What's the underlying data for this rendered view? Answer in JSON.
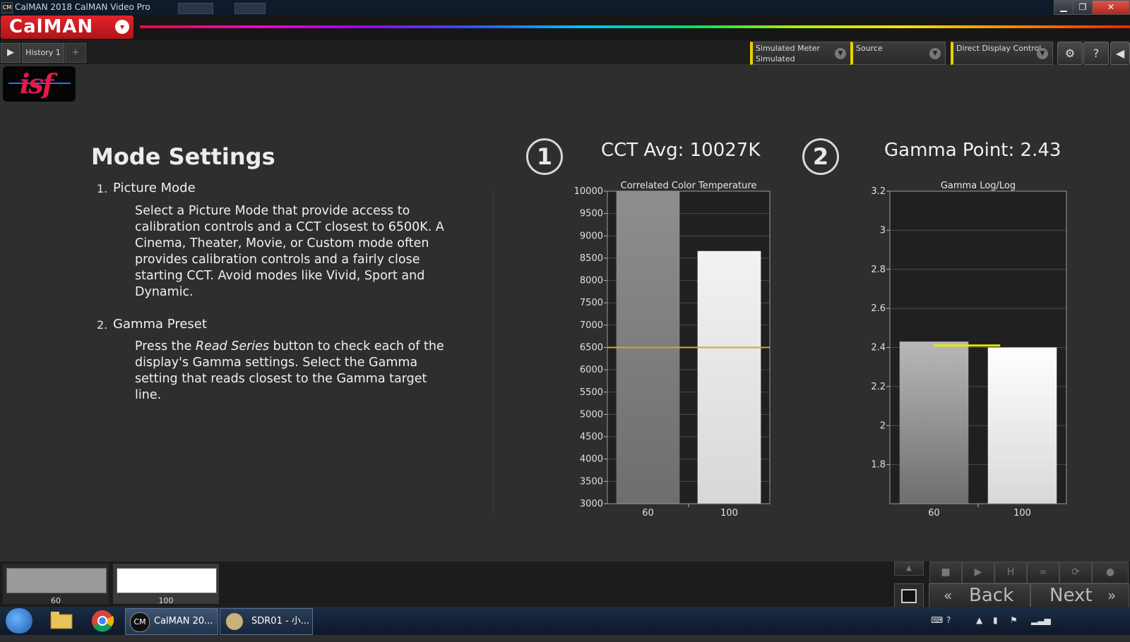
{
  "titlebar": {
    "icon_text": "CM",
    "title": "CalMAN 2018 CalMAN Video Pro",
    "minimize": "▁",
    "maximize": "❐",
    "close": "✕"
  },
  "brand": {
    "name": "CalMAN",
    "caret": "▾"
  },
  "toolbar": {
    "play_label": "▶",
    "history_tab": "History 1",
    "add_tab": "+",
    "meter": {
      "line1": "Simulated Meter",
      "line2": "Simulated"
    },
    "source": {
      "line1": "Source",
      "line2": ""
    },
    "display_control": {
      "line1": "Direct Display Control",
      "line2": ""
    },
    "settings_icon": "⚙",
    "help_icon": "?",
    "collapse_icon": "◀"
  },
  "logo": {
    "text": "isf"
  },
  "content": {
    "heading": "Mode Settings",
    "items": [
      {
        "num": "1.",
        "title": "Picture Mode",
        "body": "Select a Picture Mode that provide access to calibration controls and a CCT closest to 6500K. A Cinema, Theater, Movie, or Custom mode often provides calibration controls and a fairly close starting CCT.  Avoid modes like Vivid, Sport and Dynamic."
      },
      {
        "num": "2.",
        "title": "Gamma Preset",
        "body_before": "Press the ",
        "body_em": "Read Series",
        "body_after": " button to check each of the display's Gamma settings. Select the Gamma setting that reads closest to the Gamma target line."
      }
    ]
  },
  "chart_headers": [
    {
      "num": "1",
      "title": "CCT Avg: 10027K"
    },
    {
      "num": "2",
      "title": "Gamma Point: 2.43"
    }
  ],
  "chart_data": [
    {
      "type": "bar",
      "title": "Correlated Color Temperature",
      "categories": [
        "60",
        "100"
      ],
      "values": [
        10000,
        8660
      ],
      "target": 6500,
      "ylim": [
        3000,
        10000
      ],
      "yticks": [
        3000,
        3500,
        4000,
        4500,
        5000,
        5500,
        6000,
        6500,
        7000,
        7500,
        8000,
        8500,
        9000,
        9500,
        10000
      ],
      "bar_colors": [
        "#8e8e8e",
        "#f2f2f2"
      ],
      "target_color": "#d4a52a"
    },
    {
      "type": "bar",
      "title": "Gamma Log/Log",
      "categories": [
        "60",
        "100"
      ],
      "values": [
        2.43,
        2.4
      ],
      "target": 2.41,
      "ylim": [
        1.6,
        3.2
      ],
      "yticks": [
        1.8,
        2,
        2.2,
        2.4,
        2.6,
        2.8,
        3,
        3.2
      ],
      "bar_colors": [
        "#b8b8b8",
        "#ffffff"
      ],
      "target_color": "#e8e800"
    }
  ],
  "bottom": {
    "swatches": [
      {
        "label": "60",
        "color": "#9a9a9a"
      },
      {
        "label": "100",
        "color": "#ffffff"
      }
    ],
    "back_label": "Back",
    "next_label": "Next",
    "back_icon": "«",
    "next_icon": "»",
    "up_icon": "▲",
    "stop_icon": "■",
    "play_icon": "▶",
    "save_icon": "H",
    "loop_icon": "∞",
    "refresh_icon": "⟳"
  },
  "taskbar": {
    "calman_task": "CalMAN 20...",
    "sdr_task": "SDR01 - 小...",
    "cm_badge": "CM"
  }
}
